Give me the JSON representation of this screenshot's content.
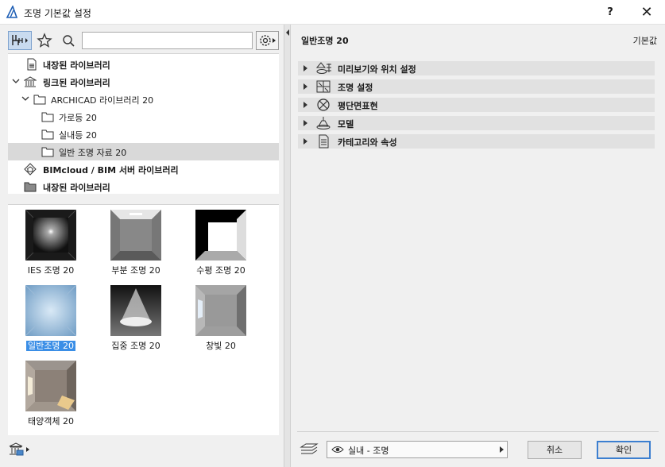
{
  "window": {
    "title": "조명 기본값 설정",
    "help": "?",
    "close": "✕"
  },
  "search": {
    "value": "",
    "placeholder": ""
  },
  "tree": [
    {
      "label": "내장된 라이브러리"
    },
    {
      "label": "링크된 라이브러리"
    },
    {
      "label": "ARCHICAD 라이브러리 20"
    },
    {
      "label": "가로등 20"
    },
    {
      "label": "실내등 20"
    },
    {
      "label": "일반 조명 자료 20"
    },
    {
      "label": "BIMcloud / BIM 서버 라이브러리"
    },
    {
      "label": "내장된 라이브러리"
    }
  ],
  "thumbnails": [
    {
      "label": "IES 조명 20"
    },
    {
      "label": "부분 조명 20"
    },
    {
      "label": "수평 조명 20"
    },
    {
      "label": "일반조명 20"
    },
    {
      "label": "집중 조명 20"
    },
    {
      "label": "창빛 20"
    },
    {
      "label": "태양객체 20"
    }
  ],
  "panel": {
    "title": "일반조명 20",
    "default_label": "기본값",
    "sections": [
      {
        "label": "미리보기와 위치 설정"
      },
      {
        "label": "조명 설정"
      },
      {
        "label": "평단면표현"
      },
      {
        "label": "모델"
      },
      {
        "label": "카테고리와 속성"
      }
    ]
  },
  "footer": {
    "layer": "실내 - 조명",
    "cancel": "취소",
    "ok": "확인"
  },
  "colors": {
    "selection": "#3a8ee6",
    "accent": "#3c7fd0"
  }
}
